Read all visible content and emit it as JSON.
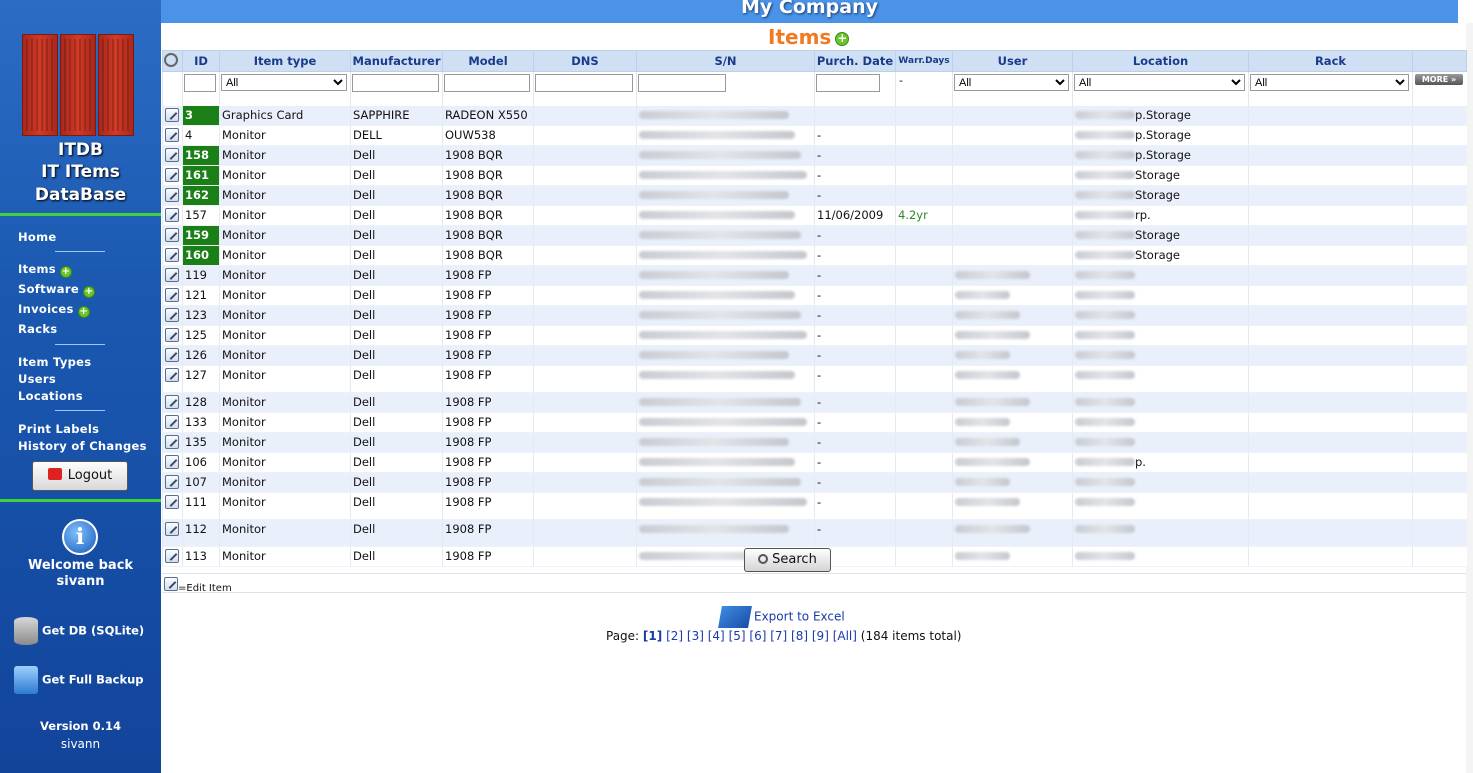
{
  "app": {
    "company": "My Company",
    "brand_line1": "ITDB",
    "brand_line2": "IT ITems",
    "brand_line3": "DataBase",
    "page_title": "Items"
  },
  "nav": {
    "home": "Home",
    "items": "Items",
    "software": "Software",
    "invoices": "Invoices",
    "racks": "Racks",
    "item_types": "Item Types",
    "users": "Users",
    "locations": "Locations",
    "print_labels": "Print Labels",
    "history": "History of Changes",
    "logout": "Logout"
  },
  "side": {
    "welcome_line1": "Welcome back",
    "welcome_user": "sivann",
    "get_db": "Get DB (SQLite)",
    "get_backup": "Get Full Backup",
    "version": "Version 0.14",
    "version_user": "sivann"
  },
  "table": {
    "columns": [
      "ID",
      "Item type",
      "Manufacturer",
      "Model",
      "DNS",
      "S/N",
      "Purch. Date",
      "Warr.Days",
      "User",
      "Location",
      "Rack"
    ],
    "filter_all": "All",
    "warr_filter": "-",
    "more": "MORE »",
    "rows": [
      {
        "id": "3",
        "green": true,
        "type": "Graphics Card",
        "man": "SAPPHIRE",
        "model": "RADEON X550",
        "pd": "",
        "warr": "",
        "loc": "p.Storage"
      },
      {
        "id": "4",
        "green": false,
        "type": "Monitor",
        "man": "DELL",
        "model": "OUW538",
        "pd": "-",
        "warr": "",
        "loc": "p.Storage"
      },
      {
        "id": "158",
        "green": true,
        "type": "Monitor",
        "man": "Dell",
        "model": "1908 BQR",
        "pd": "-",
        "warr": "",
        "loc": "p.Storage"
      },
      {
        "id": "161",
        "green": true,
        "type": "Monitor",
        "man": "Dell",
        "model": "1908 BQR",
        "pd": "-",
        "warr": "",
        "loc": "Storage"
      },
      {
        "id": "162",
        "green": true,
        "type": "Monitor",
        "man": "Dell",
        "model": "1908 BQR",
        "pd": "-",
        "warr": "",
        "loc": "Storage"
      },
      {
        "id": "157",
        "green": false,
        "type": "Monitor",
        "man": "Dell",
        "model": "1908 BQR",
        "pd": "11/06/2009",
        "warr": "4.2yr",
        "loc": "rp."
      },
      {
        "id": "159",
        "green": true,
        "type": "Monitor",
        "man": "Dell",
        "model": "1908 BQR",
        "pd": "-",
        "warr": "",
        "loc": "Storage"
      },
      {
        "id": "160",
        "green": true,
        "type": "Monitor",
        "man": "Dell",
        "model": "1908 BQR",
        "pd": "-",
        "warr": "",
        "loc": "Storage"
      },
      {
        "id": "119",
        "green": false,
        "type": "Monitor",
        "man": "Dell",
        "model": "1908 FP",
        "pd": "-",
        "warr": "",
        "loc": ""
      },
      {
        "id": "121",
        "green": false,
        "type": "Monitor",
        "man": "Dell",
        "model": "1908 FP",
        "pd": "-",
        "warr": "",
        "loc": ""
      },
      {
        "id": "123",
        "green": false,
        "type": "Monitor",
        "man": "Dell",
        "model": "1908 FP",
        "pd": "-",
        "warr": "",
        "loc": ""
      },
      {
        "id": "125",
        "green": false,
        "type": "Monitor",
        "man": "Dell",
        "model": "1908 FP",
        "pd": "-",
        "warr": "",
        "loc": ""
      },
      {
        "id": "126",
        "green": false,
        "type": "Monitor",
        "man": "Dell",
        "model": "1908 FP",
        "pd": "-",
        "warr": "",
        "loc": ""
      },
      {
        "id": "127",
        "green": false,
        "type": "Monitor",
        "man": "Dell",
        "model": "1908 FP",
        "pd": "-",
        "warr": "",
        "loc": "",
        "tall": true
      },
      {
        "id": "128",
        "green": false,
        "type": "Monitor",
        "man": "Dell",
        "model": "1908 FP",
        "pd": "-",
        "warr": "",
        "loc": ""
      },
      {
        "id": "133",
        "green": false,
        "type": "Monitor",
        "man": "Dell",
        "model": "1908 FP",
        "pd": "-",
        "warr": "",
        "loc": ""
      },
      {
        "id": "135",
        "green": false,
        "type": "Monitor",
        "man": "Dell",
        "model": "1908 FP",
        "pd": "-",
        "warr": "",
        "loc": ""
      },
      {
        "id": "106",
        "green": false,
        "type": "Monitor",
        "man": "Dell",
        "model": "1908 FP",
        "pd": "-",
        "warr": "",
        "loc": "p."
      },
      {
        "id": "107",
        "green": false,
        "type": "Monitor",
        "man": "Dell",
        "model": "1908 FP",
        "pd": "-",
        "warr": "",
        "loc": ""
      },
      {
        "id": "111",
        "green": false,
        "type": "Monitor",
        "man": "Dell",
        "model": "1908 FP",
        "pd": "-",
        "warr": "",
        "loc": "",
        "tall": true
      },
      {
        "id": "112",
        "green": false,
        "type": "Monitor",
        "man": "Dell",
        "model": "1908 FP",
        "pd": "-",
        "warr": "",
        "loc": "",
        "tall": true
      },
      {
        "id": "113",
        "green": false,
        "type": "Monitor",
        "man": "Dell",
        "model": "1908 FP",
        "pd": "-",
        "warr": "",
        "loc": ""
      }
    ]
  },
  "search_label": "Search",
  "legend_text": "=Edit Item",
  "export_label": "Export to Excel",
  "pager": {
    "label": "Page:",
    "pages": [
      "[1]",
      "[2]",
      "[3]",
      "[4]",
      "[5]",
      "[6]",
      "[7]",
      "[8]",
      "[9]",
      "[All]"
    ],
    "current": "[1]",
    "total": "(184 items total)"
  },
  "colors": {
    "sidebar": "#1a58b0",
    "topbar": "#4a93e8",
    "accent_orange": "#f07a22",
    "id_green": "#1a7f16"
  }
}
